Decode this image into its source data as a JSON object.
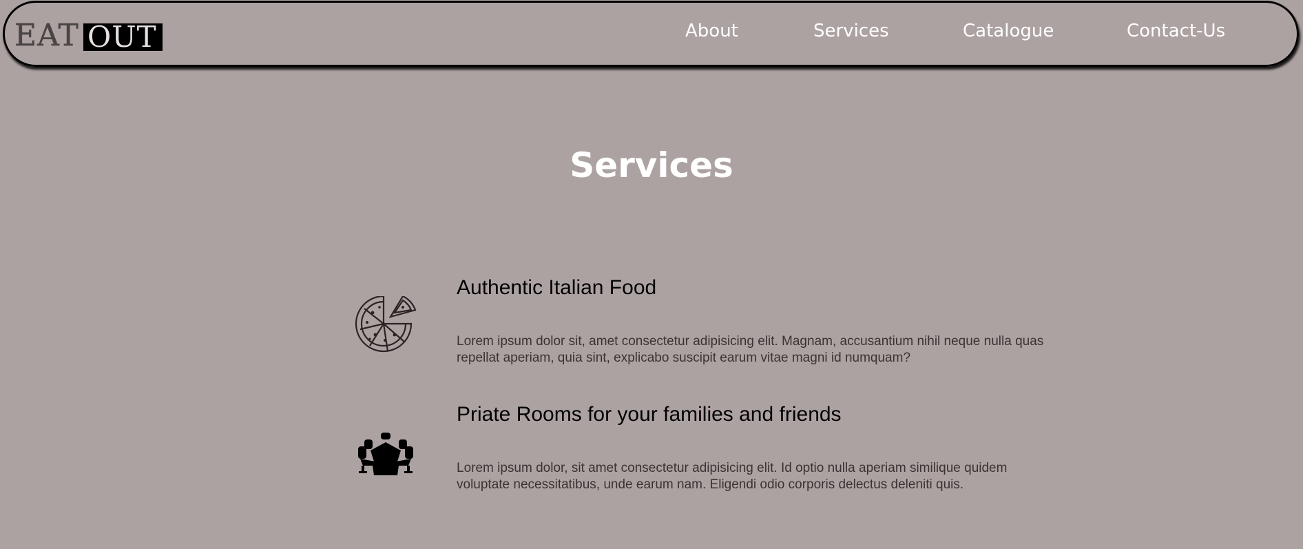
{
  "header": {
    "logo": {
      "word_one": "EAT",
      "word_two": "OUT"
    },
    "nav": [
      {
        "label": "About"
      },
      {
        "label": "Services"
      },
      {
        "label": "Catalogue"
      },
      {
        "label": "Contact-Us"
      }
    ]
  },
  "main": {
    "title": "Services",
    "services": [
      {
        "icon": "pizza-icon",
        "heading": "Authentic Italian Food",
        "text": "Lorem ipsum dolor sit, amet consectetur adipisicing elit. Magnam, accusantium nihil neque nulla quas repellat aperiam, quia sint, explicabo suscipit earum vitae magni id numquam?"
      },
      {
        "icon": "private-room-table-icon",
        "heading": "Priate Rooms for your families and friends",
        "text": "Lorem ipsum dolor, sit amet consectetur adipisicing elit. Id optio nulla aperiam similique quidem voluptate necessitatibus, unde earum nam. Eligendi odio corporis delectus deleniti quis."
      }
    ]
  },
  "colors": {
    "background": "#ada2a2",
    "nav_text": "#ffffff",
    "heading_text": "#000000",
    "body_text": "#3a3333"
  }
}
